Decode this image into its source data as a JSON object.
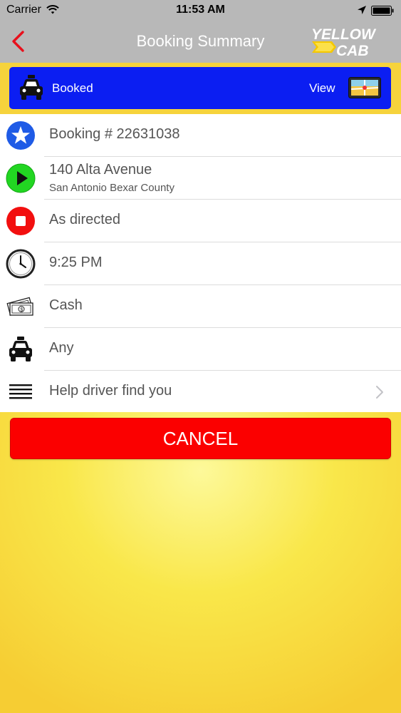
{
  "status_bar": {
    "carrier": "Carrier",
    "time": "11:53 AM",
    "icons": [
      "wifi-icon",
      "location-icon",
      "battery-icon"
    ]
  },
  "nav_bar": {
    "title": "Booking Summary",
    "back_icon": "chevron-left-icon",
    "logo": {
      "line1": "YELLOW",
      "line2": "CAB"
    }
  },
  "banner": {
    "status": "Booked",
    "view_label": "View",
    "icons": [
      "taxi-icon",
      "map-icon"
    ]
  },
  "rows": [
    {
      "icon": "star-icon",
      "text": "Booking # 22631038"
    },
    {
      "icon": "play-icon",
      "text": "140 Alta Avenue",
      "subtext": "San Antonio Bexar County"
    },
    {
      "icon": "stop-icon",
      "text": "As directed"
    },
    {
      "icon": "clock-icon",
      "text": "9:25 PM"
    },
    {
      "icon": "cash-icon",
      "text": "Cash"
    },
    {
      "icon": "taxi-icon",
      "text": "Any"
    },
    {
      "icon": "menu-icon",
      "text": "Help driver find you"
    }
  ],
  "cancel_label": "CANCEL",
  "colors": {
    "nav_bg": "#b8b8b8",
    "banner_blue": "#0b1ef2",
    "cancel_red": "#fb0000",
    "background_yellow": "#f9e74a",
    "star_blue": "#1f5be6",
    "play_green": "#22d622",
    "stop_red": "#f20f0f"
  }
}
